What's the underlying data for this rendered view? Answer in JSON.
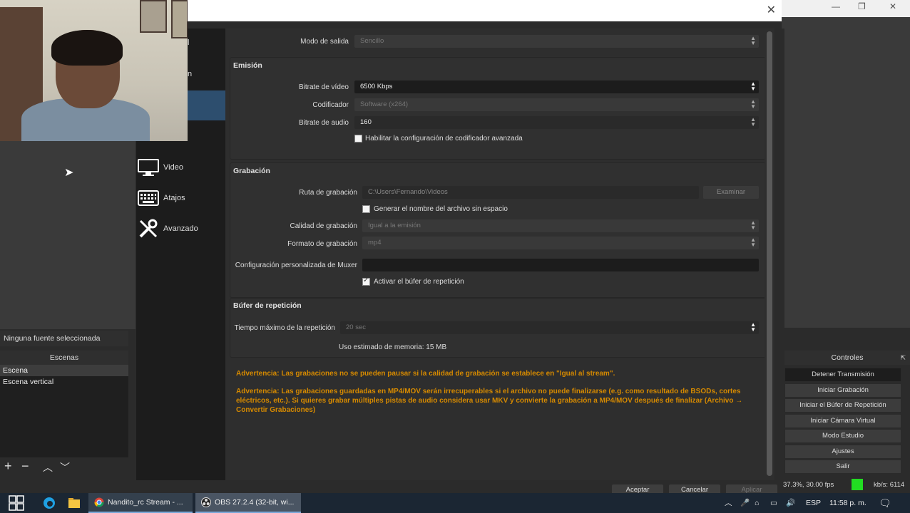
{
  "obs": {
    "no_source": "Ninguna fuente seleccionada",
    "scenes_header": "Escenas",
    "scenes": [
      "Escena",
      "Escena vertical"
    ],
    "controls_header": "Controles",
    "controls": [
      "Detener Transmisión",
      "Iniciar Grabación",
      "Iniciar el Búfer de Repetición",
      "Iniciar Cámara Virtual",
      "Modo Estudio",
      "Ajustes",
      "Salir"
    ],
    "status_fps": "37.3%, 30.00 fps",
    "status_kbs": "kb/s: 6114",
    "partial_menu": [
      "l",
      "n"
    ]
  },
  "sidebar": {
    "items": [
      {
        "label": "Video",
        "icon": "monitor-icon"
      },
      {
        "label": "Atajos",
        "icon": "keyboard-icon"
      },
      {
        "label": "Avanzado",
        "icon": "tools-icon"
      }
    ]
  },
  "output": {
    "mode_label": "Modo de salida",
    "mode_value": "Sencillo",
    "streaming": {
      "title": "Emisión",
      "video_bitrate_label": "Bitrate de vídeo",
      "video_bitrate_value": "6500 Kbps",
      "encoder_label": "Codificador",
      "encoder_value": "Software (x264)",
      "audio_bitrate_label": "Bitrate de audio",
      "audio_bitrate_value": "160",
      "advanced_checkbox": "Habilitar la configuración de codificador avanzada"
    },
    "recording": {
      "title": "Grabación",
      "path_label": "Ruta de grabación",
      "path_value": "C:\\Users\\Fernando\\Videos",
      "browse_button": "Examinar",
      "nospace_checkbox": "Generar el nombre del archivo sin espacio",
      "quality_label": "Calidad de grabación",
      "quality_value": "Igual a la emisión",
      "format_label": "Formato de grabación",
      "format_value": "mp4",
      "muxer_label": "Configuración personalizada de Muxer",
      "muxer_value": "",
      "replay_checkbox": "Activar el búfer de repetición"
    },
    "replay": {
      "title": "Búfer de repetición",
      "max_time_label": "Tiempo máximo de la repetición",
      "max_time_value": "20 sec",
      "memory_usage": "Uso estimado de memoria: 15 MB"
    },
    "warning1": "Advertencia: Las grabaciones no se pueden pausar si la calidad de grabación se establece en \"Igual al stream\".",
    "warning2": "Advertencia: Las grabaciones guardadas en MP4/MOV serán irrecuperables si el archivo no puede finalizarse (e.g. como resultado de BSODs, cortes eléctricos, etc.). Si quieres grabar múltiples pistas de audio considera usar MKV y convierte la grabación a MP4/MOV después de finalizar (Archivo → Convertir Grabaciones)"
  },
  "dialog_buttons": {
    "accept": "Aceptar",
    "cancel": "Cancelar",
    "apply": "Aplicar"
  },
  "taskbar": {
    "apps": [
      {
        "label": "Nandito_rc Stream - ...",
        "icon": "chrome-icon"
      },
      {
        "label": "OBS 27.2.4 (32-bit, wi...",
        "icon": "obs-icon"
      }
    ],
    "lang": "ESP",
    "time": "11:58 p. m."
  },
  "colors": {
    "warning": "#d68a00",
    "selected": "#2d4e6e",
    "green_indicator": "#22dd22"
  }
}
